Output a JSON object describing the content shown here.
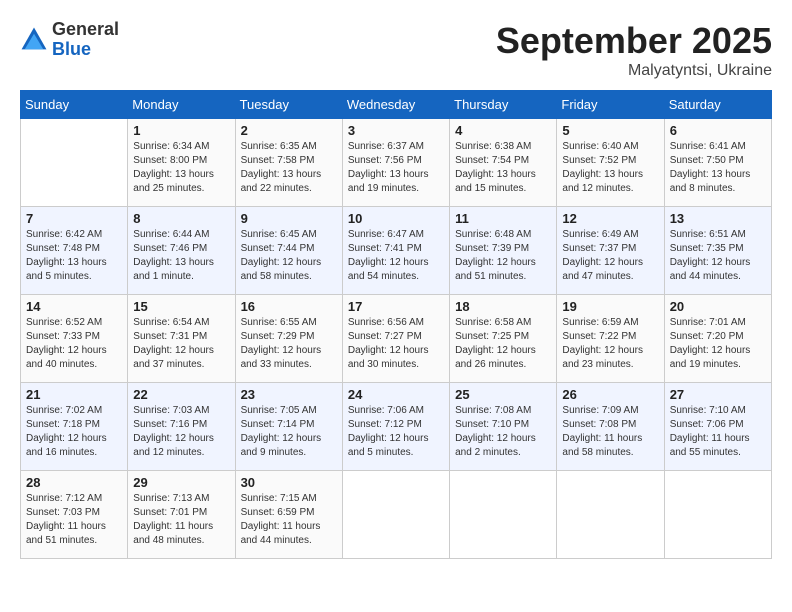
{
  "header": {
    "logo_line1": "General",
    "logo_line2": "Blue",
    "month_title": "September 2025",
    "location": "Malyatyntsi, Ukraine"
  },
  "days_of_week": [
    "Sunday",
    "Monday",
    "Tuesday",
    "Wednesday",
    "Thursday",
    "Friday",
    "Saturday"
  ],
  "weeks": [
    [
      {
        "day": "",
        "info": ""
      },
      {
        "day": "1",
        "info": "Sunrise: 6:34 AM\nSunset: 8:00 PM\nDaylight: 13 hours\nand 25 minutes."
      },
      {
        "day": "2",
        "info": "Sunrise: 6:35 AM\nSunset: 7:58 PM\nDaylight: 13 hours\nand 22 minutes."
      },
      {
        "day": "3",
        "info": "Sunrise: 6:37 AM\nSunset: 7:56 PM\nDaylight: 13 hours\nand 19 minutes."
      },
      {
        "day": "4",
        "info": "Sunrise: 6:38 AM\nSunset: 7:54 PM\nDaylight: 13 hours\nand 15 minutes."
      },
      {
        "day": "5",
        "info": "Sunrise: 6:40 AM\nSunset: 7:52 PM\nDaylight: 13 hours\nand 12 minutes."
      },
      {
        "day": "6",
        "info": "Sunrise: 6:41 AM\nSunset: 7:50 PM\nDaylight: 13 hours\nand 8 minutes."
      }
    ],
    [
      {
        "day": "7",
        "info": "Sunrise: 6:42 AM\nSunset: 7:48 PM\nDaylight: 13 hours\nand 5 minutes."
      },
      {
        "day": "8",
        "info": "Sunrise: 6:44 AM\nSunset: 7:46 PM\nDaylight: 13 hours\nand 1 minute."
      },
      {
        "day": "9",
        "info": "Sunrise: 6:45 AM\nSunset: 7:44 PM\nDaylight: 12 hours\nand 58 minutes."
      },
      {
        "day": "10",
        "info": "Sunrise: 6:47 AM\nSunset: 7:41 PM\nDaylight: 12 hours\nand 54 minutes."
      },
      {
        "day": "11",
        "info": "Sunrise: 6:48 AM\nSunset: 7:39 PM\nDaylight: 12 hours\nand 51 minutes."
      },
      {
        "day": "12",
        "info": "Sunrise: 6:49 AM\nSunset: 7:37 PM\nDaylight: 12 hours\nand 47 minutes."
      },
      {
        "day": "13",
        "info": "Sunrise: 6:51 AM\nSunset: 7:35 PM\nDaylight: 12 hours\nand 44 minutes."
      }
    ],
    [
      {
        "day": "14",
        "info": "Sunrise: 6:52 AM\nSunset: 7:33 PM\nDaylight: 12 hours\nand 40 minutes."
      },
      {
        "day": "15",
        "info": "Sunrise: 6:54 AM\nSunset: 7:31 PM\nDaylight: 12 hours\nand 37 minutes."
      },
      {
        "day": "16",
        "info": "Sunrise: 6:55 AM\nSunset: 7:29 PM\nDaylight: 12 hours\nand 33 minutes."
      },
      {
        "day": "17",
        "info": "Sunrise: 6:56 AM\nSunset: 7:27 PM\nDaylight: 12 hours\nand 30 minutes."
      },
      {
        "day": "18",
        "info": "Sunrise: 6:58 AM\nSunset: 7:25 PM\nDaylight: 12 hours\nand 26 minutes."
      },
      {
        "day": "19",
        "info": "Sunrise: 6:59 AM\nSunset: 7:22 PM\nDaylight: 12 hours\nand 23 minutes."
      },
      {
        "day": "20",
        "info": "Sunrise: 7:01 AM\nSunset: 7:20 PM\nDaylight: 12 hours\nand 19 minutes."
      }
    ],
    [
      {
        "day": "21",
        "info": "Sunrise: 7:02 AM\nSunset: 7:18 PM\nDaylight: 12 hours\nand 16 minutes."
      },
      {
        "day": "22",
        "info": "Sunrise: 7:03 AM\nSunset: 7:16 PM\nDaylight: 12 hours\nand 12 minutes."
      },
      {
        "day": "23",
        "info": "Sunrise: 7:05 AM\nSunset: 7:14 PM\nDaylight: 12 hours\nand 9 minutes."
      },
      {
        "day": "24",
        "info": "Sunrise: 7:06 AM\nSunset: 7:12 PM\nDaylight: 12 hours\nand 5 minutes."
      },
      {
        "day": "25",
        "info": "Sunrise: 7:08 AM\nSunset: 7:10 PM\nDaylight: 12 hours\nand 2 minutes."
      },
      {
        "day": "26",
        "info": "Sunrise: 7:09 AM\nSunset: 7:08 PM\nDaylight: 11 hours\nand 58 minutes."
      },
      {
        "day": "27",
        "info": "Sunrise: 7:10 AM\nSunset: 7:06 PM\nDaylight: 11 hours\nand 55 minutes."
      }
    ],
    [
      {
        "day": "28",
        "info": "Sunrise: 7:12 AM\nSunset: 7:03 PM\nDaylight: 11 hours\nand 51 minutes."
      },
      {
        "day": "29",
        "info": "Sunrise: 7:13 AM\nSunset: 7:01 PM\nDaylight: 11 hours\nand 48 minutes."
      },
      {
        "day": "30",
        "info": "Sunrise: 7:15 AM\nSunset: 6:59 PM\nDaylight: 11 hours\nand 44 minutes."
      },
      {
        "day": "",
        "info": ""
      },
      {
        "day": "",
        "info": ""
      },
      {
        "day": "",
        "info": ""
      },
      {
        "day": "",
        "info": ""
      }
    ]
  ]
}
